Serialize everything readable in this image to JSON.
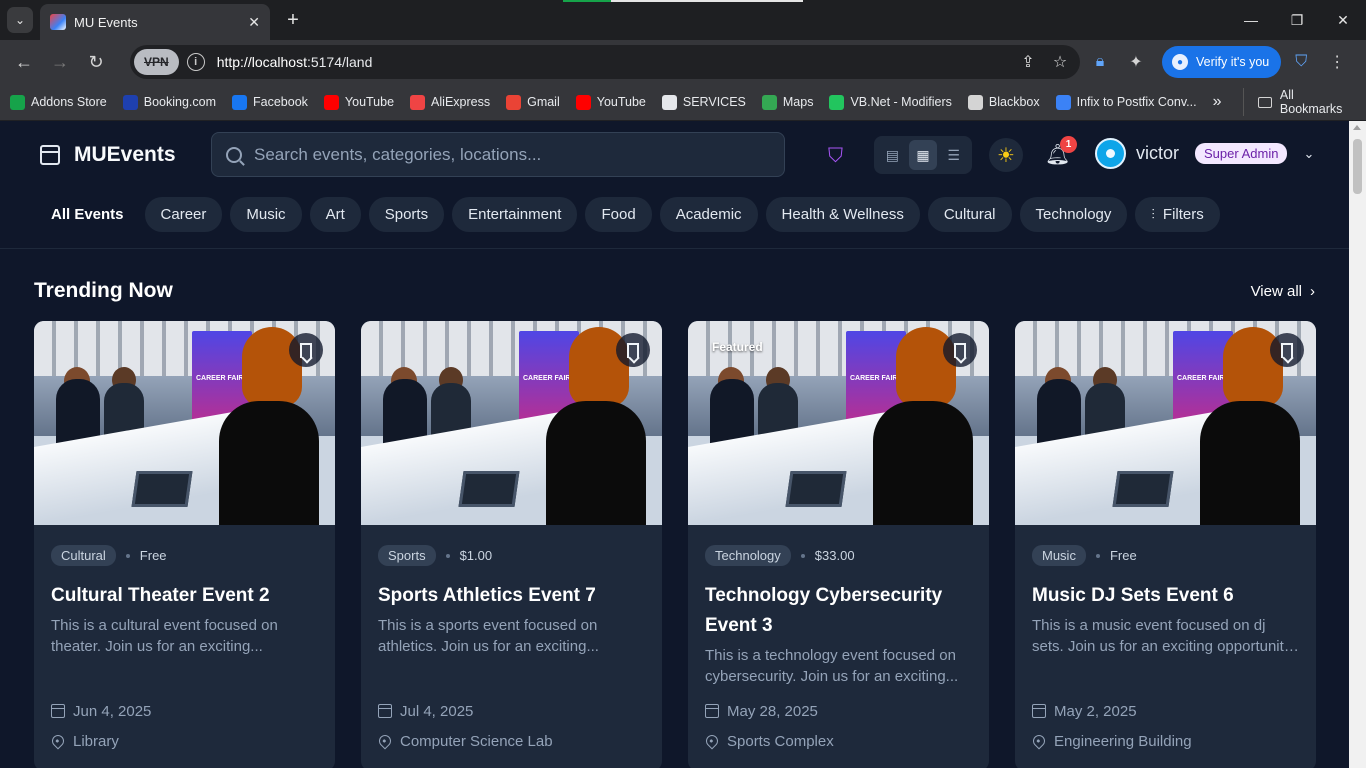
{
  "browser": {
    "tab_title": "MU Events",
    "url_host": "http://localhost",
    "url_rest": ":5174/land",
    "vpn_label": "VPN",
    "verify_label": "Verify it's you",
    "bookmarks": [
      {
        "label": "Addons Store",
        "color": "#16a34a"
      },
      {
        "label": "Booking.com",
        "color": "#1e40af"
      },
      {
        "label": "Facebook",
        "color": "#1877f2"
      },
      {
        "label": "YouTube",
        "color": "#ff0000"
      },
      {
        "label": "AliExpress",
        "color": "#ef4444"
      },
      {
        "label": "Gmail",
        "color": "#ea4335"
      },
      {
        "label": "YouTube",
        "color": "#ff0000"
      },
      {
        "label": "SERVICES",
        "color": "#e5e7eb"
      },
      {
        "label": "Maps",
        "color": "#34a853"
      },
      {
        "label": "VB.Net - Modifiers",
        "color": "#22c55e"
      },
      {
        "label": "Blackbox",
        "color": "#d4d4d4"
      },
      {
        "label": "Infix to Postfix Conv...",
        "color": "#3b82f6"
      }
    ],
    "all_bookmarks": "All Bookmarks"
  },
  "app": {
    "brand": "MUEvents",
    "search_placeholder": "Search events, categories, locations...",
    "notification_count": "1",
    "username": "victor",
    "role": "Super Admin"
  },
  "categories": [
    "All Events",
    "Career",
    "Music",
    "Art",
    "Sports",
    "Entertainment",
    "Food",
    "Academic",
    "Health & Wellness",
    "Cultural",
    "Technology"
  ],
  "filters_label": "Filters",
  "section": {
    "title": "Trending Now",
    "view_all": "View all"
  },
  "events": [
    {
      "category": "Cultural",
      "price": "Free",
      "title": "Cultural Theater Event 2",
      "description": "This is a cultural event focused on theater. Join us for an exciting...",
      "date": "Jun 4, 2025",
      "location": "Library",
      "featured": ""
    },
    {
      "category": "Sports",
      "price": "$1.00",
      "title": "Sports Athletics Event 7",
      "description": "This is a sports event focused on athletics. Join us for an exciting...",
      "date": "Jul 4, 2025",
      "location": "Computer Science Lab",
      "featured": ""
    },
    {
      "category": "Technology",
      "price": "$33.00",
      "title": "Technology Cybersecurity Event 3",
      "description": "This is a technology event focused on cybersecurity. Join us for an exciting...",
      "date": "May 28, 2025",
      "location": "Sports Complex",
      "featured": "Featured"
    },
    {
      "category": "Music",
      "price": "Free",
      "title": "Music DJ Sets Event 6",
      "description": "This is a music event focused on dj sets. Join us for an exciting opportunity to...",
      "date": "May 2, 2025",
      "location": "Engineering Building",
      "featured": ""
    }
  ],
  "colors": {
    "accent": "#a855f7",
    "page_bg": "#0f172a",
    "card_bg": "#1e293b",
    "badge": "#ef4444"
  }
}
